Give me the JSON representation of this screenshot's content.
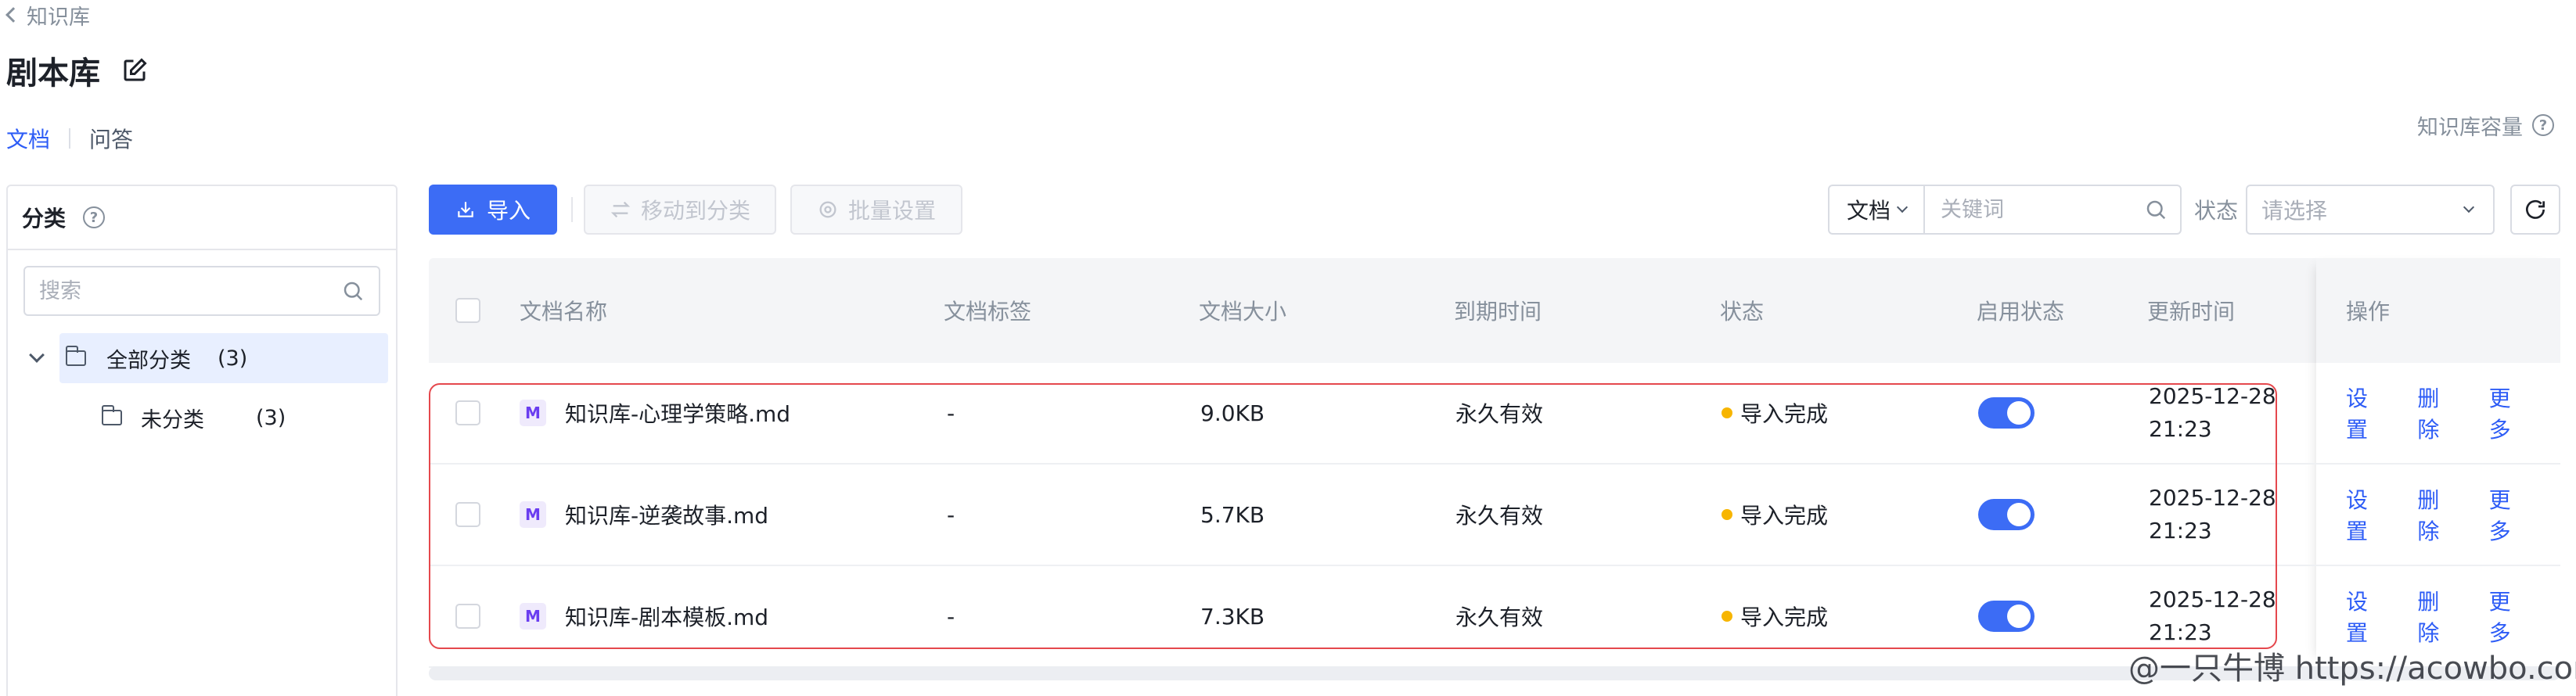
{
  "header": {
    "back_label": "知识库",
    "title": "剧本库",
    "tabs": [
      {
        "label": "文档",
        "active": true
      },
      {
        "label": "问答",
        "active": false
      }
    ],
    "capacity_label": "知识库容量",
    "help_glyph": "?"
  },
  "sidebar": {
    "title": "分类",
    "help_glyph": "?",
    "search_placeholder": "搜索",
    "tree": {
      "all": {
        "label": "全部分类",
        "count": "(3)"
      },
      "sub": {
        "label": "未分类",
        "count": "(3)"
      }
    }
  },
  "toolbar": {
    "import_label": "导入",
    "move_label": "移动到分类",
    "batch_label": "批量设置",
    "filter_type": "文档",
    "keyword_placeholder": "关键词",
    "status_label": "状态",
    "status_placeholder": "请选择"
  },
  "table": {
    "columns": {
      "name": "文档名称",
      "tags": "文档标签",
      "size": "文档大小",
      "expire": "到期时间",
      "status": "状态",
      "enabled": "启用状态",
      "updated": "更新时间",
      "actions": "操作"
    },
    "rows": [
      {
        "icon": "M",
        "name": "知识库-心理学策略.md",
        "tags": "-",
        "size": "9.0KB",
        "expire": "永久有效",
        "status": "导入完成",
        "enabled": true,
        "date": "2025-12-28",
        "time": "21:23"
      },
      {
        "icon": "M",
        "name": "知识库-逆袭故事.md",
        "tags": "-",
        "size": "5.7KB",
        "expire": "永久有效",
        "status": "导入完成",
        "enabled": true,
        "date": "2025-12-28",
        "time": "21:23"
      },
      {
        "icon": "M",
        "name": "知识库-剧本模板.md",
        "tags": "-",
        "size": "7.3KB",
        "expire": "永久有效",
        "status": "导入完成",
        "enabled": true,
        "date": "2025-12-28",
        "time": "21:23"
      }
    ],
    "actions": {
      "settings": "设置",
      "delete": "删除",
      "more": "更多"
    }
  },
  "watermark": "@一只牛博 https://acowbo.com",
  "colors": {
    "accent": "#3c6cf5",
    "status_dot": "#f7b500",
    "highlight": "#e5484d"
  }
}
